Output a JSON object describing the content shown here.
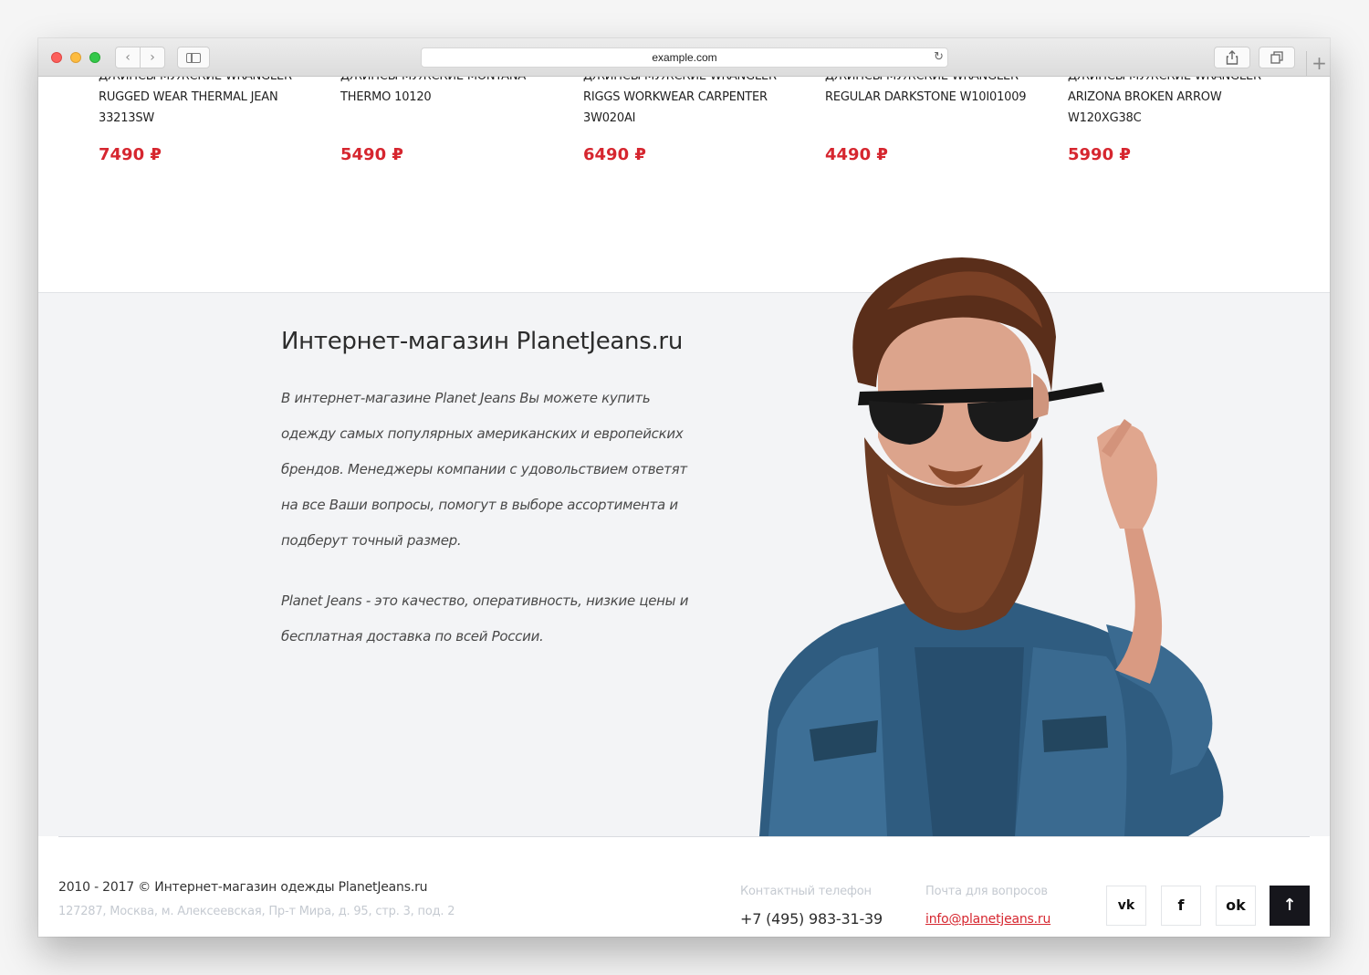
{
  "browser": {
    "url": "example.com",
    "icons": {
      "back": "chevron-left-icon",
      "forward": "chevron-right-icon",
      "sidebar": "sidebar-icon",
      "reload": "reload-icon",
      "share": "share-icon",
      "tabs": "tabs-icon",
      "new_tab": "plus-icon"
    }
  },
  "products": [
    {
      "title_top": "ДЖИНСЫ МУЖСКИЕ WRANGLER",
      "title_1": "RUGGED WEAR THERMAL JEAN",
      "title_2": "33213SW",
      "price": "7490 ₽"
    },
    {
      "title_top": "ДЖИНСЫ МУЖСКИЕ MONTANA",
      "title_1": "THERMO 10120",
      "title_2": "",
      "price": "5490 ₽"
    },
    {
      "title_top": "ДЖИНСЫ МУЖСКИЕ WRANGLER",
      "title_1": "RIGGS WORKWEAR CARPENTER",
      "title_2": "3W020AI",
      "price": "6490 ₽"
    },
    {
      "title_top": "ДЖИНСЫ МУЖСКИЕ WRANGLER",
      "title_1": "REGULAR DARKSTONE W10I01009",
      "title_2": "",
      "price": "4490 ₽"
    },
    {
      "title_top": "ДЖИНСЫ МУЖСКИЕ WRANGLER",
      "title_1": "ARIZONA BROKEN ARROW",
      "title_2": "W120XG38C",
      "price": "5990 ₽"
    }
  ],
  "about": {
    "heading": "Интернет-магазин PlanetJeans.ru",
    "paragraph_1": "В интернет-магазине Planet Jeans Вы можете купить одежду самых популярных американских и европейских брендов. Менеджеры компании с удовольствием ответят на все Ваши вопросы, помогут в выборе ассортимента и подберут точный размер.",
    "paragraph_2": "Planet Jeans - это качество, оперативность, низкие цены и бесплатная доставка по всей России."
  },
  "footer": {
    "copyright": "2010 - 2017 © Интернет-магазин одежды PlanetJeans.ru",
    "address": "127287, Москва, м. Алексеевская, Пр-т Мира, д. 95, стр. 3, под. 2",
    "phone_label": "Контактный телефон",
    "phone": "+7 (495) 983-31-39",
    "email_label": "Почта для вопросов",
    "email": "info@planetjeans.ru",
    "social": {
      "vk_label": "vk",
      "fb_label": "f",
      "ok_label": "ok",
      "up_label": "↑"
    }
  },
  "colors": {
    "price": "#d6262f",
    "about_bg": "#f3f4f6",
    "footer_muted": "#c5cad1",
    "scroll_top_bg": "#16161c"
  }
}
